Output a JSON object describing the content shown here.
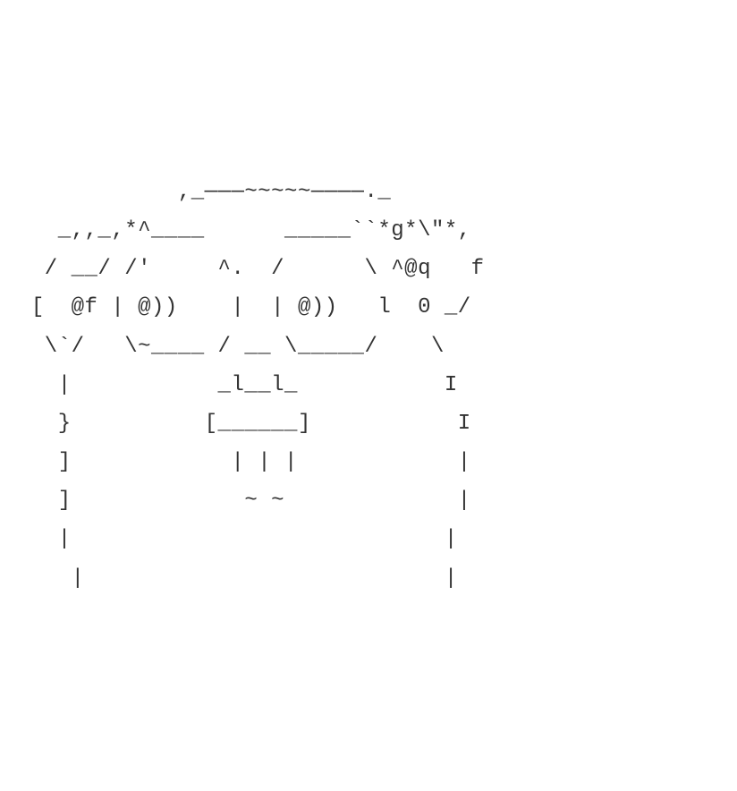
{
  "ascii": {
    "lines": [
      "            ,_———~~~~~————._",
      "   _,,_,*^____      _____``*g*\\\"*,",
      "  / __/ /'     ^.  /      \\ ^@q   f",
      " [  @f | @))    |  | @))   l  0 _/",
      "  \\`/   \\~____ / __ \\_____/    \\",
      "   |           _l__l_           I",
      "   }          [______]           I",
      "   ]            | | |            |",
      "   ]             ~ ~             |",
      "   |                            |",
      "    |                           |"
    ]
  }
}
